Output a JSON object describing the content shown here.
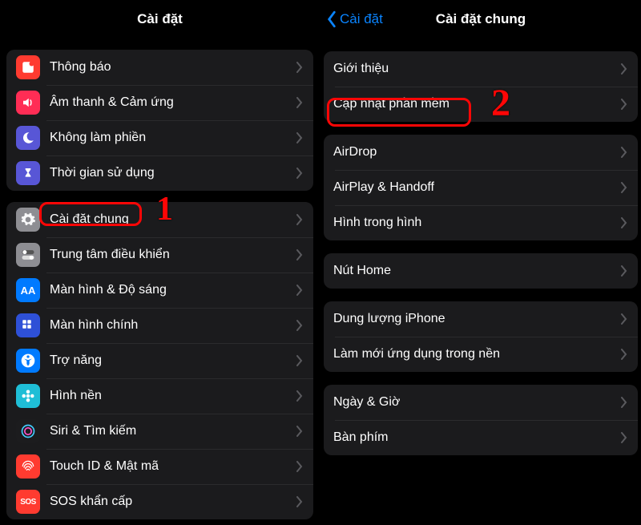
{
  "colors": {
    "annotation": "#fd0606",
    "link": "#0a84ff"
  },
  "leftPane": {
    "title": "Cài đặt",
    "groups": [
      {
        "items": [
          {
            "key": "notifications",
            "label": "Thông báo",
            "iconBg": "#ff3b30",
            "icon": "notifications"
          },
          {
            "key": "sound",
            "label": "Âm thanh & Cảm ứng",
            "iconBg": "#ff2d55",
            "icon": "sound"
          },
          {
            "key": "dnd",
            "label": "Không làm phiền",
            "iconBg": "#5856d6",
            "icon": "moon"
          },
          {
            "key": "screentime",
            "label": "Thời gian sử dụng",
            "iconBg": "#5856d6",
            "icon": "hourglass"
          }
        ]
      },
      {
        "items": [
          {
            "key": "general",
            "label": "Cài đặt chung",
            "iconBg": "#8e8e93",
            "icon": "gear",
            "highlighted": true
          },
          {
            "key": "controlcenter",
            "label": "Trung tâm điều khiển",
            "iconBg": "#8e8e93",
            "icon": "switches"
          },
          {
            "key": "display",
            "label": "Màn hình & Độ sáng",
            "iconBg": "#007aff",
            "icon": "aa"
          },
          {
            "key": "homescreen",
            "label": "Màn hình chính",
            "iconBg": "#2e50d7",
            "icon": "grid"
          },
          {
            "key": "accessibility",
            "label": "Trợ năng",
            "iconBg": "#007aff",
            "icon": "accessibility"
          },
          {
            "key": "wallpaper",
            "label": "Hình nền",
            "iconBg": "#1fbed6",
            "icon": "flower"
          },
          {
            "key": "siri",
            "label": "Siri & Tìm kiếm",
            "iconBg": "#1c1c1e",
            "icon": "siri"
          },
          {
            "key": "touchid",
            "label": "Touch ID & Mật mã",
            "iconBg": "#ff3b30",
            "icon": "fingerprint"
          },
          {
            "key": "sos",
            "label": "SOS khẩn cấp",
            "iconBg": "#ff3b30",
            "icon": "sos"
          }
        ]
      }
    ]
  },
  "rightPane": {
    "backLabel": "Cài đặt",
    "title": "Cài đặt chung",
    "groups": [
      {
        "items": [
          {
            "key": "about",
            "label": "Giới thiệu"
          },
          {
            "key": "swupdate",
            "label": "Cập nhật phần mềm",
            "highlighted": true
          }
        ]
      },
      {
        "items": [
          {
            "key": "airdrop",
            "label": "AirDrop"
          },
          {
            "key": "airplay",
            "label": "AirPlay & Handoff"
          },
          {
            "key": "pip",
            "label": "Hình trong hình"
          }
        ]
      },
      {
        "items": [
          {
            "key": "homebtn",
            "label": "Nút Home"
          }
        ]
      },
      {
        "items": [
          {
            "key": "storage",
            "label": "Dung lượng iPhone"
          },
          {
            "key": "bgrefresh",
            "label": "Làm mới ứng dụng trong nền"
          }
        ]
      },
      {
        "items": [
          {
            "key": "datetime",
            "label": "Ngày & Giờ"
          },
          {
            "key": "keyboard",
            "label": "Bàn phím"
          }
        ]
      }
    ]
  },
  "annotations": {
    "step1": "1",
    "step2": "2"
  }
}
